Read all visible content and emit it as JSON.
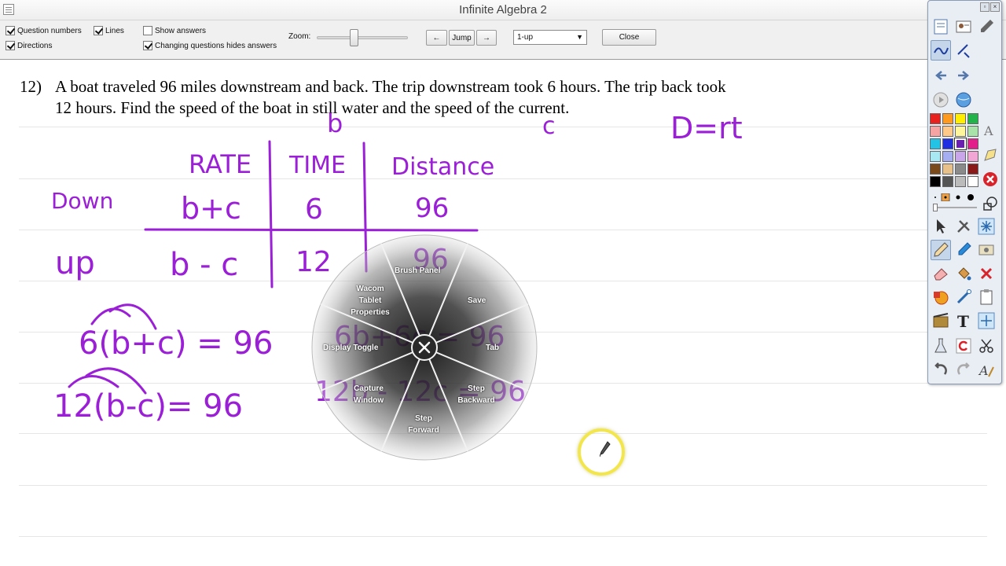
{
  "window": {
    "title": "Infinite Algebra 2"
  },
  "toolbar": {
    "checkboxes": [
      {
        "label": "Question numbers",
        "checked": true
      },
      {
        "label": "Lines",
        "checked": true
      },
      {
        "label": "Show answers",
        "checked": false
      },
      {
        "label": "Directions",
        "checked": true
      },
      {
        "label": "Changing questions hides answers",
        "checked": true
      }
    ],
    "zoom_label": "Zoom:",
    "prev_label": "←",
    "jump_label": "Jump",
    "next_label": "→",
    "view_select": "1-up",
    "close_label": "Close"
  },
  "question": {
    "number": "12)",
    "line1": "A boat traveled 96 miles downstream and back.  The trip downstream took 6 hours.  The trip back took",
    "line2": "12 hours.  Find the speed of the boat in still water and the speed of the current."
  },
  "handwriting": {
    "b": "b",
    "c": "c",
    "formula": "D=rt",
    "header_rate": "RATE",
    "header_time": "TIME",
    "header_distance": "Distance",
    "row_down": "Down",
    "row_up": "up",
    "down_rate": "b+c",
    "down_time": "6",
    "down_dist": "96",
    "up_rate": "b - c",
    "up_time": "12",
    "up_dist": "96",
    "eq1": "6(b+c) = 96",
    "eq2": "12(b-c)= 96",
    "work1": "6b+6c = 96",
    "work2": "12b - 12c = 96"
  },
  "radial_menu": {
    "items": [
      "Brush Panel",
      "Save",
      "Tab",
      "Step Backward",
      "Step Forward",
      "Capture Window",
      "Display Toggle",
      "Wacom Tablet Properties"
    ]
  },
  "colors": {
    "ink": "#9a1fd6",
    "cursor": "#f2e64c",
    "palette": [
      "#e8201e",
      "#ff9a1e",
      "#ffee00",
      "#22b34a",
      "#f6a3a3",
      "#ffc98a",
      "#fff59a",
      "#a9e3a9",
      "#23c3e6",
      "#1f2ee0",
      "#6a1fb0",
      "#e21f8a",
      "#a8e8f2",
      "#a6aef2",
      "#c9a6ea",
      "#f2a6d6",
      "#7a4a1a",
      "#e8c08a",
      "#8a8a8a",
      "#8a1a1a",
      "#000000",
      "#555555",
      "#bbbbbb",
      "#ffffff"
    ]
  }
}
